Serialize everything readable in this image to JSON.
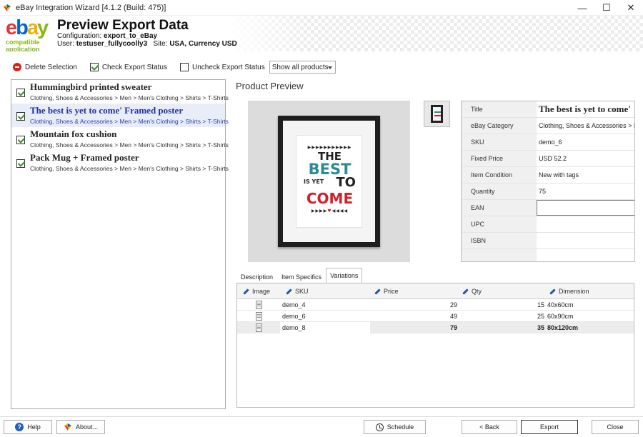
{
  "window": {
    "title": "eBay Integration Wizard [4.1.2 (Build: 475)]",
    "minimize": "—",
    "maximize": "☐",
    "close": "✕"
  },
  "header": {
    "logo_e": "e",
    "logo_b": "b",
    "logo_a": "a",
    "logo_y": "y",
    "logo_line1": "compatible",
    "logo_line2": "application",
    "title": "Preview Export Data",
    "config_label": "Configuration:",
    "config_value": "export_to_eBay",
    "user_label": "User:",
    "user_value": "testuser_fullycoolly3",
    "site_label": "Site:",
    "site_value": "USA, Currency USD"
  },
  "toolbar": {
    "delete_label": "Delete Selection",
    "check_label": "Check Export Status",
    "uncheck_label": "Uncheck Export Status",
    "filter_value": "Show all products"
  },
  "products": [
    {
      "name": "Hummingbird printed sweater",
      "category": "Clothing, Shoes & Accessories > Men > Men's Clothing > Shirts > T-Shirts"
    },
    {
      "name": "The best is yet to come' Framed poster",
      "category": "Clothing, Shoes & Accessories > Men > Men's Clothing > Shirts > T-Shirts"
    },
    {
      "name": "Mountain fox cushion",
      "category": "Clothing, Shoes & Accessories > Men > Men's Clothing > Shirts > T-Shirts"
    },
    {
      "name": "Pack Mug + Framed poster",
      "category": "Clothing, Shoes & Accessories > Men > Men's Clothing > Shirts > T-Shirts"
    }
  ],
  "preview": {
    "heading": "Product Preview",
    "poster_lines": [
      "THE",
      "BEST",
      "IS YET",
      "TO",
      "COME"
    ]
  },
  "properties": [
    {
      "label": "Title",
      "value": "The best is yet to come'"
    },
    {
      "label": "eBay Category",
      "value": "Clothing, Shoes & Accessories > Men"
    },
    {
      "label": "SKU",
      "value": "demo_6"
    },
    {
      "label": "Fixed Price",
      "value": "USD 52.2"
    },
    {
      "label": "Item Condition",
      "value": "New with tags"
    },
    {
      "label": "Quantity",
      "value": "75"
    },
    {
      "label": "EAN",
      "value": ""
    },
    {
      "label": "UPC",
      "value": ""
    },
    {
      "label": "ISBN",
      "value": ""
    }
  ],
  "tabs": [
    "Description",
    "Item Specifics",
    "Variations"
  ],
  "variations": {
    "columns": [
      "Image",
      "SKU",
      "Price",
      "Qty",
      "Dimension"
    ],
    "rows": [
      {
        "sku": "demo_4",
        "price": "29",
        "qty": "15",
        "dimension": "40x60cm"
      },
      {
        "sku": "demo_6",
        "price": "49",
        "qty": "25",
        "dimension": "60x90cm"
      },
      {
        "sku": "demo_8",
        "price": "79",
        "qty": "35",
        "dimension": "80x120cm"
      }
    ]
  },
  "footer": {
    "help": "Help",
    "about": "About...",
    "schedule": "Schedule",
    "back": "< Back",
    "export": "Export",
    "close": "Close"
  },
  "colors": {
    "ebay_red": "#e53238",
    "ebay_blue": "#0064d2",
    "ebay_yellow": "#f5af02",
    "ebay_green": "#86b817",
    "selected_text": "#1f2fa8",
    "poster_teal": "#2d8a96",
    "poster_red": "#d0212b"
  }
}
